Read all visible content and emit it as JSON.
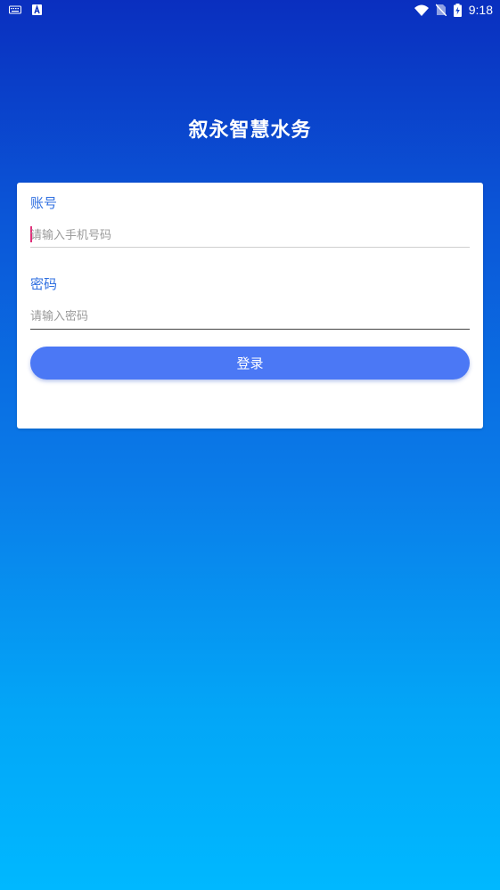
{
  "status_bar": {
    "time": "9:18",
    "icons": [
      "keyboard-icon",
      "a-badge-icon",
      "wifi-icon",
      "no-sim-icon",
      "battery-charging-icon"
    ]
  },
  "app": {
    "title": "叙永智慧水务"
  },
  "login_form": {
    "account_label": "账号",
    "account_placeholder": "请输入手机号码",
    "account_value": "",
    "password_label": "密码",
    "password_placeholder": "请输入密码",
    "password_value": "",
    "submit_label": "登录"
  },
  "colors": {
    "label": "#2f6fe0",
    "button": "#4b78f5",
    "background_top": "#0a2fbf",
    "background_bottom": "#00b8ff"
  }
}
